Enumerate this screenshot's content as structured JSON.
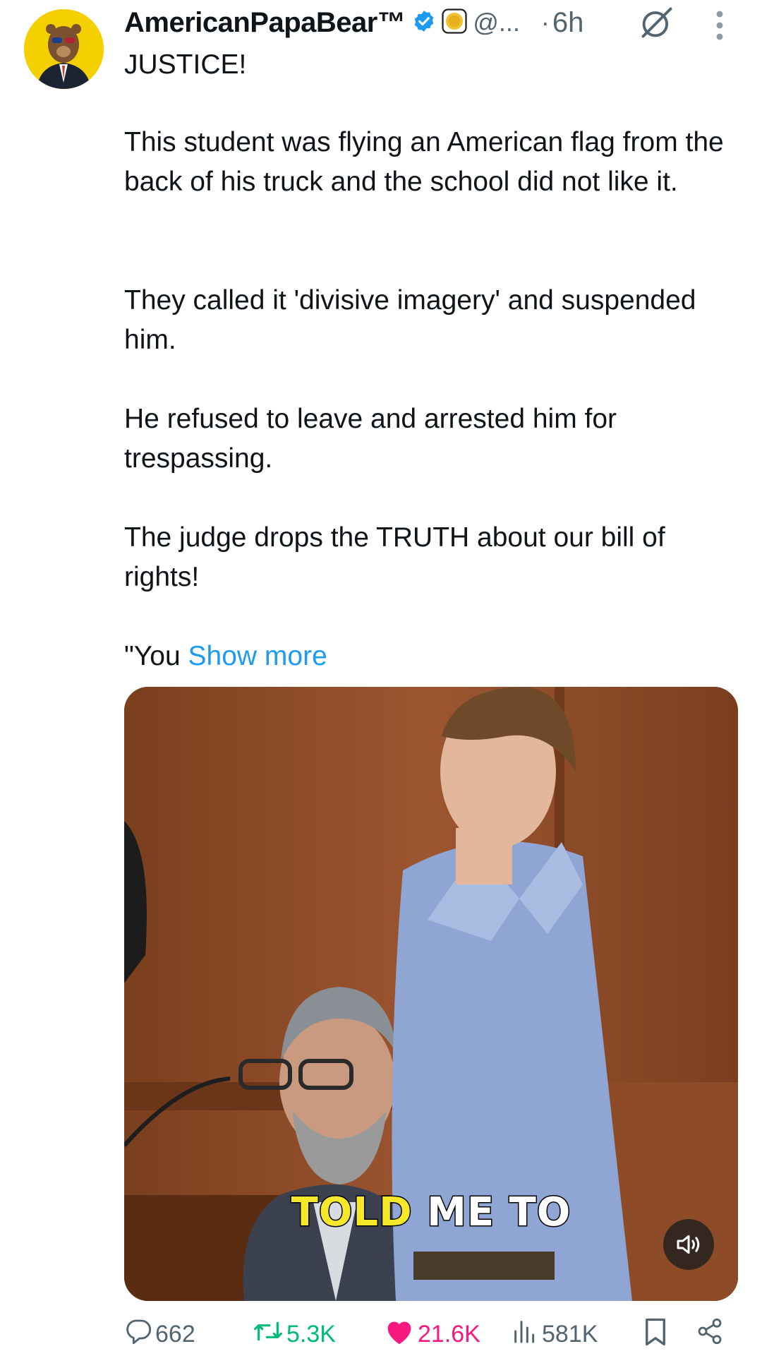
{
  "author": {
    "display_name": "AmericanPapaBear™",
    "handle": "@...",
    "time_separator": "·",
    "time": "6h",
    "icons": [
      "verified-badge-icon",
      "gold-coin-icon",
      "grok-icon",
      "more-options-icon"
    ]
  },
  "tweet": {
    "lines": [
      "JUSTICE!",
      "This student was flying an American flag from the back of his truck and the school did not like it.",
      "They called it 'divisive imagery' and suspended him.",
      "He refused to leave and arrested him for trespassing.",
      "The judge drops the TRUTH about our bill of rights!",
      "\"You"
    ],
    "show_more": "Show more"
  },
  "media": {
    "caption_highlight": "TOLD",
    "caption_rest": "ME TO",
    "icons": [
      "volume-icon"
    ]
  },
  "actions": {
    "replies": "662",
    "reposts": "5.3K",
    "likes": "21.6K",
    "views": "581K",
    "icons": [
      "reply-icon",
      "retweet-icon",
      "heart-icon",
      "views-icon",
      "bookmark-icon",
      "share-icon"
    ]
  },
  "colors": {
    "link": "#1d9bf0",
    "verified": "#1d9bf0",
    "retweet": "#00ba7c",
    "like": "#f91880",
    "muted_text": "#536471",
    "avatar_bg": "#f5d000"
  }
}
